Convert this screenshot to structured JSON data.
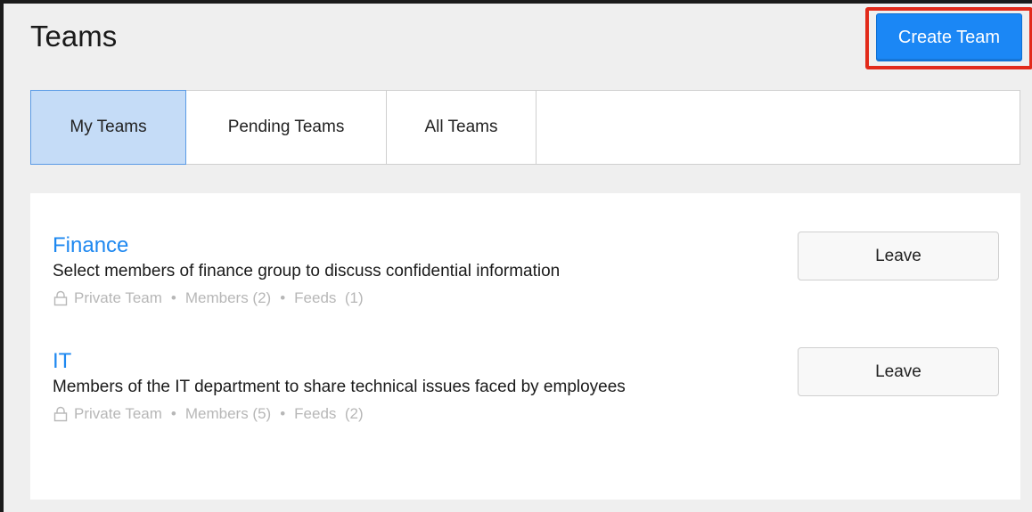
{
  "header": {
    "title": "Teams",
    "create_button_label": "Create Team"
  },
  "tabs": [
    {
      "label": "My Teams",
      "active": true
    },
    {
      "label": "Pending Teams",
      "active": false
    },
    {
      "label": "All Teams",
      "active": false
    }
  ],
  "teams": [
    {
      "name": "Finance",
      "description": "Select members of finance group to discuss confidential information",
      "privacy": "Private Team",
      "members": "Members (2)",
      "feeds": "Feeds  (1)",
      "leave_label": "Leave"
    },
    {
      "name": "IT",
      "description": "Members of the IT department to share technical issues faced by employees",
      "privacy": "Private Team",
      "members": "Members (5)",
      "feeds": "Feeds  (2)",
      "leave_label": "Leave"
    }
  ],
  "meta_separator": "•",
  "icons": {
    "privacy": "lock-icon"
  },
  "colors": {
    "accent": "#1b87f5",
    "link": "#1e88f0",
    "highlight": "#e22a1a",
    "active_tab": "#c5dcf7"
  }
}
